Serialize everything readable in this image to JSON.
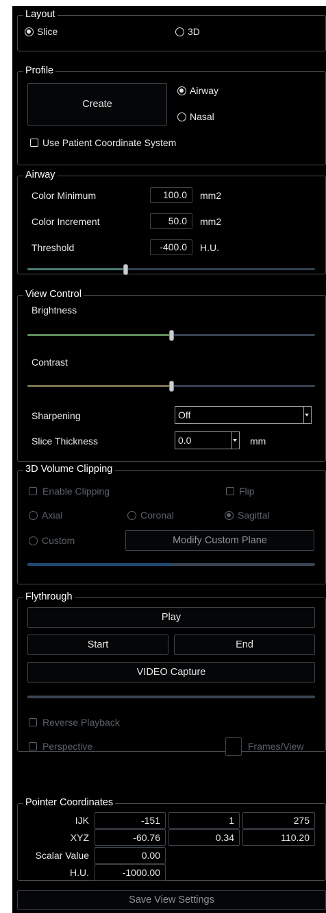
{
  "layout": {
    "title": "Layout",
    "options": [
      {
        "label": "Slice",
        "selected": true
      },
      {
        "label": "3D",
        "selected": false
      }
    ]
  },
  "profile": {
    "title": "Profile",
    "create_label": "Create",
    "options": [
      {
        "label": "Airway",
        "selected": true
      },
      {
        "label": "Nasal",
        "selected": false
      }
    ],
    "patient_coords_label": "Use Patient Coordinate System",
    "patient_coords_checked": false
  },
  "airway": {
    "title": "Airway",
    "rows": [
      {
        "label": "Color Minimum",
        "value": "100.0",
        "unit": "mm2"
      },
      {
        "label": "Color Increment",
        "value": "50.0",
        "unit": "mm2"
      },
      {
        "label": "Threshold",
        "value": "-400.0",
        "unit": "H.U."
      }
    ],
    "slider_fraction": 0.34,
    "slider_color": "#4a7a72"
  },
  "view_control": {
    "title": "View Control",
    "brightness_label": "Brightness",
    "brightness_fraction": 0.5,
    "brightness_color": "#5f8a5a",
    "contrast_label": "Contrast",
    "contrast_fraction": 0.5,
    "contrast_color": "#7f7450",
    "sharpening_label": "Sharpening",
    "sharpening_value": "Off",
    "slice_thickness_label": "Slice Thickness",
    "slice_thickness_value": "0.0",
    "slice_thickness_unit": "mm"
  },
  "clipping": {
    "title": "3D Volume Clipping",
    "enable_label": "Enable Clipping",
    "enable_checked": false,
    "flip_label": "Flip",
    "flip_checked": false,
    "planes": [
      {
        "label": "Axial",
        "selected": false
      },
      {
        "label": "Coronal",
        "selected": false
      },
      {
        "label": "Sagittal",
        "selected": true
      }
    ],
    "custom_label": "Custom",
    "modify_label": "Modify Custom Plane",
    "progress_fraction": 0.5
  },
  "flythrough": {
    "title": "Flythrough",
    "play_label": "Play",
    "start_label": "Start",
    "end_label": "End",
    "video_label": "VIDEO Capture",
    "progress_fraction": 0.0,
    "reverse_label": "Reverse Playback",
    "reverse_checked": false,
    "perspective_label": "Perspective",
    "perspective_checked": false,
    "frames_value": "",
    "frames_label": "Frames/View"
  },
  "pointer": {
    "title": "Pointer Coordinates",
    "ijk_label": "IJK",
    "ijk": [
      "-151",
      "1",
      "275"
    ],
    "xyz_label": "XYZ",
    "xyz": [
      "-60.76",
      "0.34",
      "110.20"
    ],
    "scalar_label": "Scalar Value",
    "scalar": "0.00",
    "hu_label": "H.U.",
    "hu": "-1000.00"
  },
  "save_label": "Save View Settings",
  "colors": {
    "background": "#000000",
    "border": "#474c53",
    "progress_fill": "#1f4a73",
    "disabled_text": "#5b6168"
  }
}
